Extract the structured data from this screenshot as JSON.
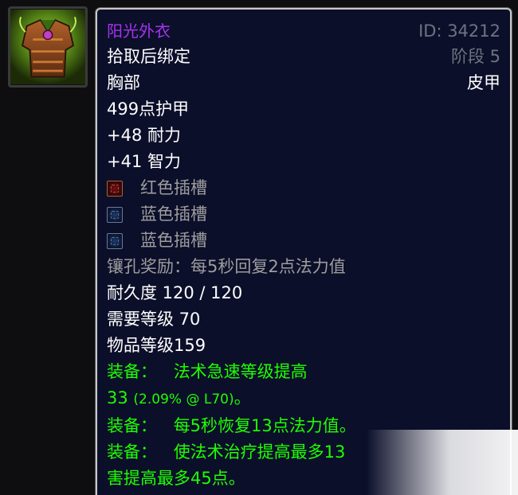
{
  "item": {
    "name": "阳光外衣",
    "id_text": "ID: 34212",
    "binding": "拾取后绑定",
    "phase": "阶段 5",
    "slot": "胸部",
    "type": "皮甲",
    "armor": "499点护甲",
    "stats": [
      "+48 耐力",
      "+41 智力"
    ],
    "sockets": [
      {
        "color": "red",
        "label": "红色插槽"
      },
      {
        "color": "blue",
        "label": "蓝色插槽"
      },
      {
        "color": "blue",
        "label": "蓝色插槽"
      }
    ],
    "socket_bonus": "镶孔奖励：每5秒回复2点法力值",
    "durability": "耐久度 120 / 120",
    "required_level": "需要等级 70",
    "item_level": "物品等级159",
    "equip_effects": [
      {
        "line1_prefix": "装备：",
        "line1_text": "法术急速等级提高",
        "line2_main": "33 ",
        "line2_small": "(2.09% @ L70)",
        "line2_end": "。"
      },
      {
        "line1_prefix": "装备：",
        "line1_text": "每5秒恢复13点法力值。"
      },
      {
        "line1_prefix": "装备：",
        "line1_text": "使法术治疗提高最多13",
        "line2_main": "害提高最多45点。"
      }
    ]
  },
  "colors": {
    "epic_purple": "#a335ee",
    "equip_green": "#1eff00",
    "socket_gray": "#9d9d9d",
    "meta_gray": "#6e7380",
    "tooltip_bg": "#0c0f2a"
  },
  "icons": {
    "item_icon": "chest-armor-icon",
    "red_socket": "red-socket-icon",
    "blue_socket": "blue-socket-icon"
  }
}
